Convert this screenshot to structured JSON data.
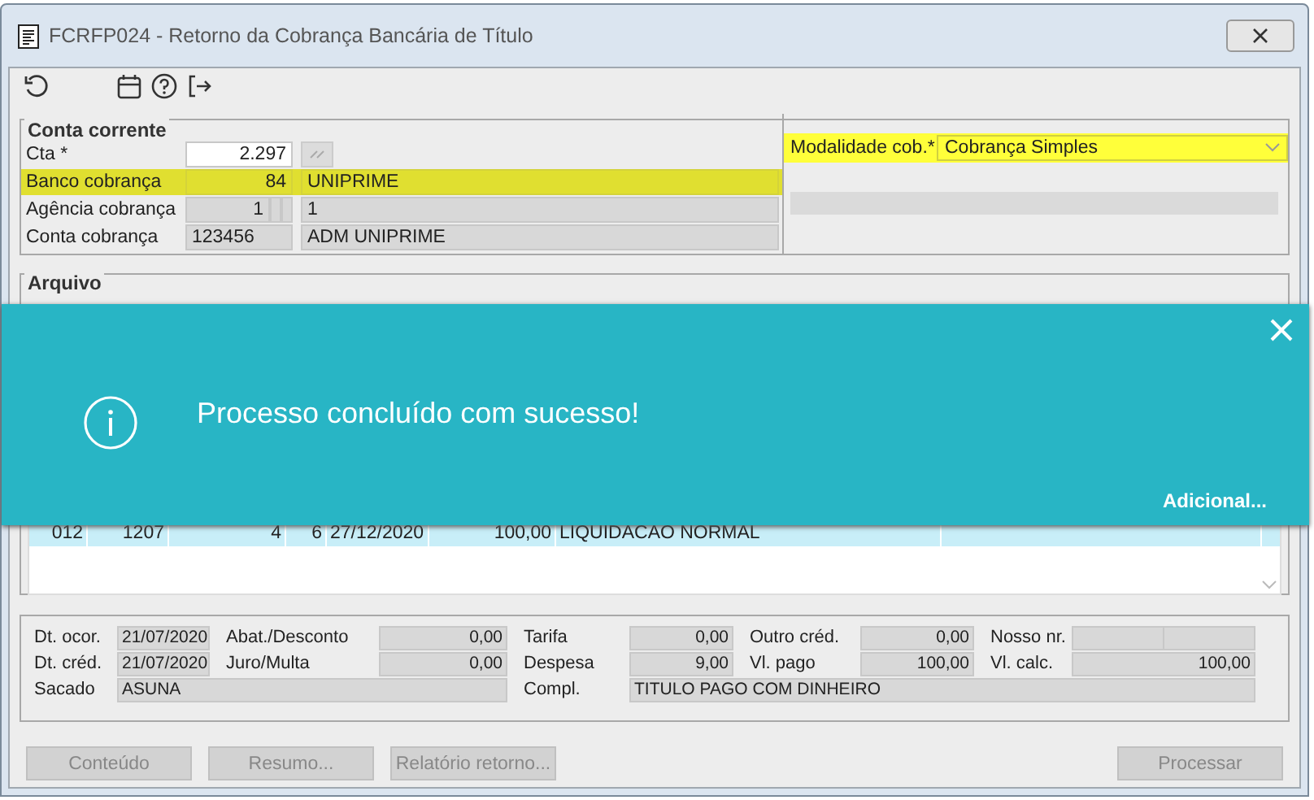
{
  "window": {
    "title": "FCRFP024 - Retorno da Cobrança Bancária de Título"
  },
  "conta_corrente": {
    "legend": "Conta corrente",
    "rows": [
      {
        "label": "Cta *",
        "code": "2.297",
        "name": "",
        "readonly": false,
        "highlighted": false,
        "kind": "lookup"
      },
      {
        "label": "Banco cobrança",
        "code": "84",
        "name": "UNIPRIME",
        "readonly": true,
        "highlighted": true,
        "kind": "plain"
      },
      {
        "label": "Agência cobrança",
        "code": "1",
        "name": "1",
        "readonly": true,
        "highlighted": false,
        "kind": "digit"
      },
      {
        "label": "Conta cobrança",
        "code": "123456",
        "name": "ADM UNIPRIME",
        "readonly": true,
        "highlighted": false,
        "kind": "left"
      }
    ],
    "modalidade": {
      "label": "Modalidade cob.*",
      "value": "Cobrança Simples",
      "highlighted": true
    }
  },
  "arquivo": {
    "legend": "Arquivo"
  },
  "notification": {
    "message": "Processo concluído com sucesso!",
    "link": "Adicional..."
  },
  "table": {
    "rows": [
      {
        "cells": [
          "012",
          "1207",
          "4",
          "6",
          "27/12/2020",
          "100,00",
          "LIQUIDACAO NORMAL",
          ""
        ],
        "selected": true
      }
    ]
  },
  "details": {
    "fields": [
      {
        "label": "Dt. ocor.",
        "value": "21/07/2020",
        "kind": "date"
      },
      {
        "label": "Abat./Desconto",
        "value": "0,00",
        "kind": "amount"
      },
      {
        "label": "Tarifa",
        "value": "0,00",
        "kind": "amount"
      },
      {
        "label": "Outro créd.",
        "value": "0,00",
        "kind": "amount"
      },
      {
        "label": "Nosso nr.",
        "kind": "split"
      },
      {
        "label": "Dt. créd.",
        "value": "21/07/2020",
        "kind": "date"
      },
      {
        "label": "Juro/Multa",
        "value": "0,00",
        "kind": "amount"
      },
      {
        "label": "Despesa",
        "value": "9,00",
        "kind": "amount"
      },
      {
        "label": "Vl. pago",
        "value": "100,00",
        "kind": "amount"
      },
      {
        "label": "Vl. calc.",
        "value": "100,00",
        "kind": "amount"
      }
    ],
    "sacado": {
      "label": "Sacado",
      "value": "ASUNA"
    },
    "compl": {
      "label": "Compl.",
      "value": "TITULO PAGO COM DINHEIRO"
    }
  },
  "buttons": [
    {
      "label": "Conteúdo",
      "disabled": true
    },
    {
      "label": "Resumo...",
      "disabled": true
    },
    {
      "label": "Relatório retorno...",
      "disabled": true
    },
    {
      "label": "Processar",
      "disabled": true
    }
  ]
}
